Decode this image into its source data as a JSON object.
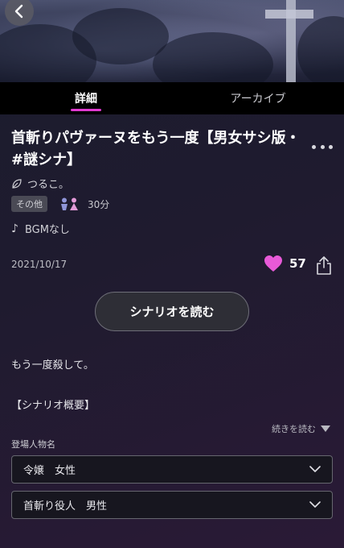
{
  "tabs": [
    {
      "label": "詳細",
      "active": true
    },
    {
      "label": "アーカイブ",
      "active": false
    }
  ],
  "scenario": {
    "title": "首斬りパヴァーヌをもう一度【男女サシ版・#謎シナ】",
    "author": "つるこ。",
    "category_tag": "その他",
    "duration": "30分",
    "bgm": "BGMなし",
    "date": "2021/10/17",
    "likes": "57"
  },
  "actions": {
    "read_button": "シナリオを読む",
    "continue_reading": "続きを読む"
  },
  "description": {
    "line1": "もう一度殺して。",
    "line2": "【シナリオ概要】"
  },
  "cast": {
    "label": "登場人物名",
    "items": [
      "令嬢　女性",
      "首斬り役人　男性"
    ]
  },
  "colors": {
    "accent": "#e03ad0",
    "heart": "#e85ad8",
    "tab_bar": "#000000"
  },
  "icons": [
    "back-arrow-icon",
    "more-dots-icon",
    "leaf-icon",
    "male-icon",
    "female-icon",
    "music-note-icon",
    "heart-icon",
    "share-icon",
    "chevron-down-icon"
  ]
}
